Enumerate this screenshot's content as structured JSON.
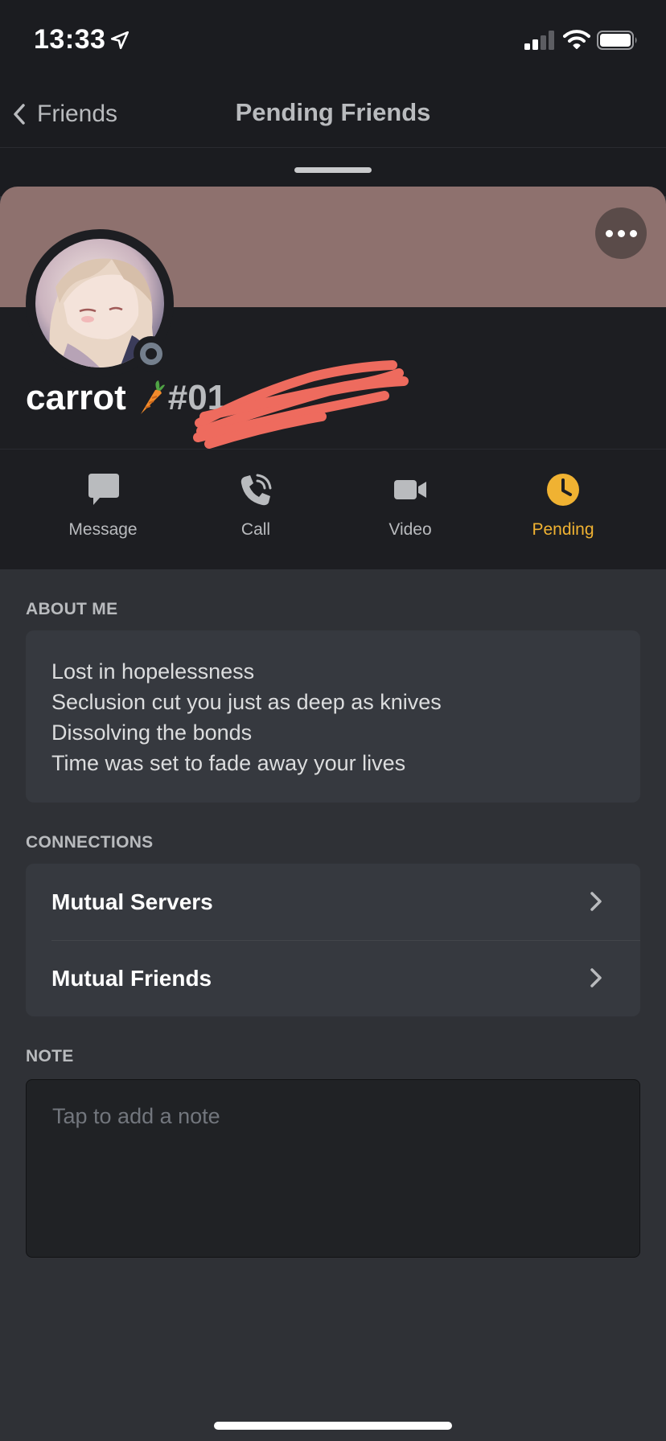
{
  "status_bar": {
    "time": "13:33",
    "icons": [
      "location-arrow-icon",
      "cellular-signal-icon",
      "wifi-icon",
      "battery-icon"
    ]
  },
  "nav": {
    "back_label": "Friends",
    "title": "Pending Friends"
  },
  "profile": {
    "username": "carrot",
    "emoji": "carrot-icon",
    "discriminator": "#01",
    "banner_color": "#8e716e",
    "status": "offline"
  },
  "actions": [
    {
      "label": "Message",
      "icon": "chat-bubble-icon"
    },
    {
      "label": "Call",
      "icon": "phone-icon"
    },
    {
      "label": "Video",
      "icon": "video-camera-icon"
    },
    {
      "label": "Pending",
      "icon": "clock-icon",
      "color": "#f0b232"
    }
  ],
  "about": {
    "heading": "ABOUT ME",
    "lines": [
      "Lost in hopelessness",
      "Seclusion cut you just as deep as knives",
      "Dissolving the bonds",
      "Time was set to fade away your lives"
    ]
  },
  "connections": {
    "heading": "CONNECTIONS",
    "items": [
      {
        "label": "Mutual Servers"
      },
      {
        "label": "Mutual Friends"
      }
    ]
  },
  "note": {
    "heading": "NOTE",
    "placeholder": "Tap to add a note"
  }
}
